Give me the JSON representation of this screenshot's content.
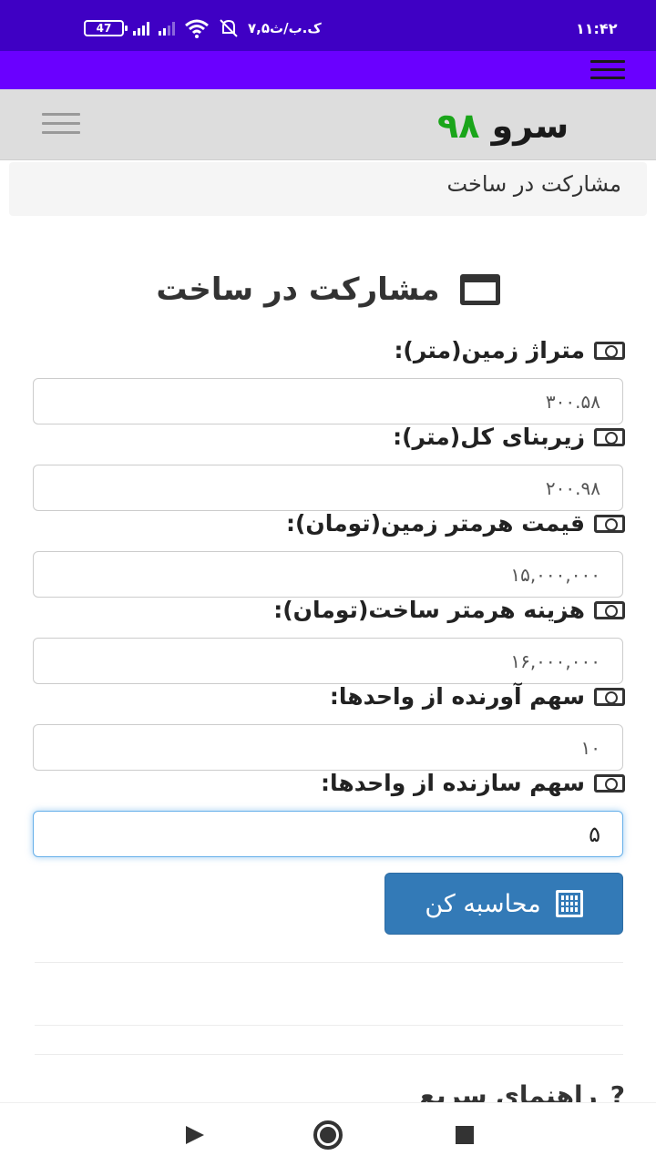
{
  "status_bar": {
    "time": "۱۱:۴۲",
    "battery": "47",
    "speed": "۷,۵ک.ب/ث"
  },
  "header": {
    "logo_text": "سرو",
    "logo_number": "۹۸"
  },
  "breadcrumb": "مشارکت در ساخت",
  "page_title": "مشارکت در ساخت",
  "fields": [
    {
      "label": "متراژ زمین(متر):",
      "value": "۳۰۰.۵۸"
    },
    {
      "label": "زیربنای کل(متر):",
      "value": "۲۰۰.۹۸"
    },
    {
      "label": "قیمت هرمتر زمین(تومان):",
      "value": "۱۵,۰۰۰,۰۰۰"
    },
    {
      "label": "هزینه هرمتر ساخت(تومان):",
      "value": "۱۶,۰۰۰,۰۰۰"
    },
    {
      "label": "سهم آورنده از واحدها:",
      "value": "۱۰"
    },
    {
      "label": "سهم سازنده از واحدها:",
      "value": "۵"
    }
  ],
  "calculate_button": "محاسبه کن",
  "help": {
    "icon": "?",
    "title": "راهنمای سریع"
  },
  "icons": {
    "money": "money-icon",
    "window": "window-icon",
    "calculator": "calculator-icon"
  },
  "colors": {
    "status_bar": "#3f00c4",
    "app_bar": "#6a00ff",
    "primary_button": "#337ab7",
    "logo_number": "#1aa51a"
  }
}
